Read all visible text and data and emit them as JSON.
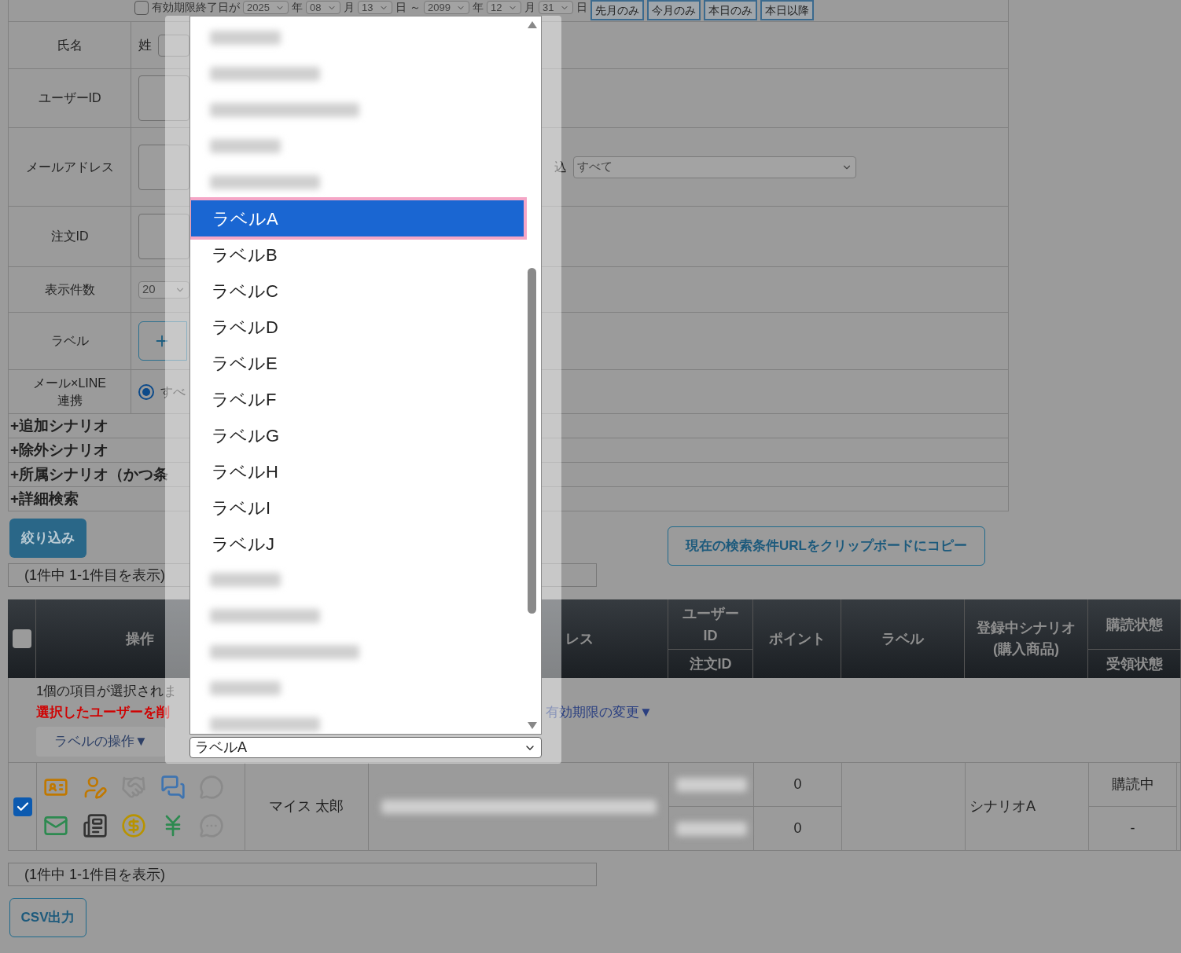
{
  "expiry_filter": {
    "checked": false,
    "label": "有効期限終了日が",
    "parts": [
      {
        "kind": "select",
        "value": "2025"
      },
      {
        "kind": "text",
        "text": "年"
      },
      {
        "kind": "select",
        "value": "08"
      },
      {
        "kind": "text",
        "text": "月"
      },
      {
        "kind": "select",
        "value": "13"
      },
      {
        "kind": "text",
        "text": "日"
      },
      {
        "kind": "text",
        "text": "～"
      },
      {
        "kind": "select",
        "value": "2099"
      },
      {
        "kind": "text",
        "text": "年"
      },
      {
        "kind": "select",
        "value": "12"
      },
      {
        "kind": "text",
        "text": "月"
      },
      {
        "kind": "select",
        "value": "31"
      },
      {
        "kind": "text",
        "text": "日"
      }
    ],
    "buttons": [
      "先月のみ",
      "今月のみ",
      "本日のみ",
      "本日以降"
    ]
  },
  "search_form": {
    "rows": [
      {
        "kind": "name",
        "label": "氏名",
        "prefix": "姓"
      },
      {
        "kind": "input",
        "label": "ユーザーID"
      },
      {
        "kind": "email",
        "label": "メールアドレス",
        "filter_label": "込",
        "filter_value": "すべて"
      },
      {
        "kind": "input",
        "label": "注文ID"
      },
      {
        "kind": "select",
        "label": "表示件数",
        "value": "20"
      },
      {
        "kind": "add",
        "label": "ラベル"
      },
      {
        "kind": "radio",
        "label": "メール×LINE",
        "label_2": "連携",
        "option": "すべ",
        "selected": true
      }
    ],
    "sections": [
      "+追加シナリオ",
      "+除外シナリオ",
      "+所属シナリオ（かつ条",
      "+詳細検索"
    ]
  },
  "filter_button": "絞り込み",
  "copy_url_button": "現在の検索条件URLをクリップボードにコピー",
  "pagination_top": "(1件中 1-1件目を表示)",
  "results": {
    "select_all": {
      "checked": false
    },
    "columns": [
      {
        "label": "操作"
      },
      {
        "label": "レス"
      },
      {
        "label": "ユーザー ID",
        "sub": "注文ID"
      },
      {
        "label": "ポイント"
      },
      {
        "label": "ラベル"
      },
      {
        "label": "登録中シナリオ",
        "label_2": "(購入商品)"
      },
      {
        "label": "購読状態",
        "sub": "受領状態"
      }
    ],
    "bulk": {
      "count_text": "1個の項目が選択されま",
      "delete_link": "選択したユーザーを削",
      "expiry_menu": "有効期限の変更▼",
      "label_menu": "ラベルの操作▼"
    },
    "rows": [
      {
        "checked": true,
        "name": "マイス 太郎",
        "points": [
          "0",
          "0"
        ],
        "scenario": "シナリオA",
        "subscription": "購読中",
        "receipt": "-"
      }
    ]
  },
  "pagination_bottom": "(1件中 1-1件目を表示)",
  "csv_button": "CSV出力",
  "label_dropdown": {
    "options": [
      {
        "kind": "blurred"
      },
      {
        "kind": "blurred"
      },
      {
        "kind": "blurred"
      },
      {
        "kind": "blurred"
      },
      {
        "kind": "blurred"
      },
      {
        "kind": "option",
        "label": "ラベルA",
        "selected": true
      },
      {
        "kind": "option",
        "label": "ラベルB",
        "selected": false
      },
      {
        "kind": "option",
        "label": "ラベルC",
        "selected": false
      },
      {
        "kind": "option",
        "label": "ラベルD",
        "selected": false
      },
      {
        "kind": "option",
        "label": "ラベルE",
        "selected": false
      },
      {
        "kind": "option",
        "label": "ラベルF",
        "selected": false
      },
      {
        "kind": "option",
        "label": "ラベルG",
        "selected": false
      },
      {
        "kind": "option",
        "label": "ラベルH",
        "selected": false
      },
      {
        "kind": "option",
        "label": "ラベルI",
        "selected": false
      },
      {
        "kind": "option",
        "label": "ラベルJ",
        "selected": false
      },
      {
        "kind": "blurred"
      },
      {
        "kind": "blurred"
      },
      {
        "kind": "blurred"
      },
      {
        "kind": "blurred"
      },
      {
        "kind": "blurred"
      }
    ],
    "value": "ラベルA"
  }
}
